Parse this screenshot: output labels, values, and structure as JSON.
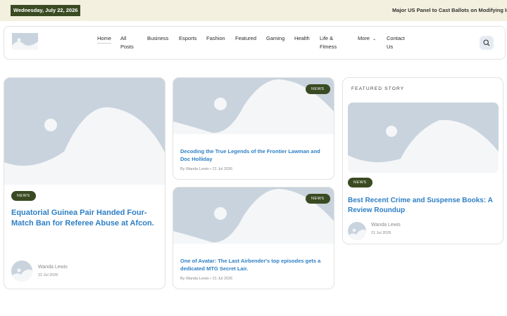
{
  "topbar": {
    "date": "Wednesday, July 22, 2026",
    "ticker": "Major US Panel to Cast Ballots on Modifying Infa"
  },
  "nav": {
    "items": [
      {
        "label": "Home"
      },
      {
        "label": "All\nPosts"
      },
      {
        "label": "Business"
      },
      {
        "label": "Esports"
      },
      {
        "label": "Fashion"
      },
      {
        "label": "Featured"
      },
      {
        "label": "Gaming"
      },
      {
        "label": "Health"
      },
      {
        "label": "Life &\nFitness"
      },
      {
        "label": "More"
      },
      {
        "label": "Contact\nUs"
      }
    ]
  },
  "main_post": {
    "badge": "NEWS",
    "title": "Equatorial Guinea Pair Handed Four-Match Ban for Referee Abuse at Afcon.",
    "author": "Wanda Lewis",
    "date": "22 Jul 2026"
  },
  "mid_posts": [
    {
      "badge": "NEWS",
      "title": "Decoding the True Legends of the Frontier Lawman and Doc Holliday",
      "author": "By Wanda Lewis",
      "date": "• 21 Jul 2026"
    },
    {
      "badge": "NEWS",
      "title": "One of Avatar: The Last Airbender's top episodes gets a dedicated MTG Secret Lair.",
      "author": "By Wanda Lewis",
      "date": "• 21 Jul 2026"
    }
  ],
  "featured": {
    "label": "FEATURED STORY",
    "badge": "NEWS",
    "title": "Best Recent Crime and Suspense Books: A Review Roundup",
    "author": "Wanda Lewis",
    "date": "21 Jul 2026"
  },
  "colors": {
    "accent_green": "#3a4a22",
    "link_blue": "#2d7fc4",
    "placeholder_bg": "#c9d3dd"
  },
  "icons": {
    "search": "search-icon",
    "chevron": "chevron-down-icon"
  }
}
